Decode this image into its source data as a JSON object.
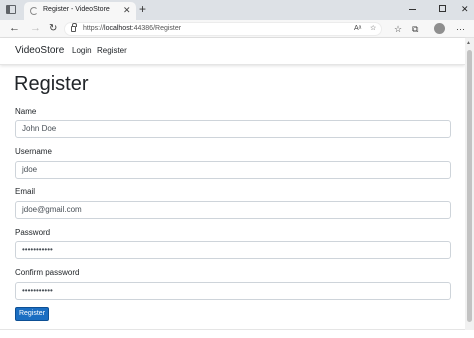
{
  "browser": {
    "tab_title": "Register - VideoStore",
    "tab_close": "✕",
    "new_tab": "+",
    "url_scheme": "https://",
    "url_host": "localhost",
    "url_rest": ":44386/Register",
    "window_buttons": {
      "close": "✕"
    },
    "nav": {
      "back": "←",
      "forward": "→",
      "reload": "↻"
    },
    "omni_icons": {
      "read_aloud": "Aᵃ",
      "favorite": "☆"
    },
    "toolbar_icons": [
      "☆",
      "⧉",
      "⊕"
    ],
    "more": "⋯"
  },
  "navbar": {
    "brand": "VideoStore",
    "links": [
      "Login",
      "Register"
    ]
  },
  "form": {
    "title": "Register",
    "fields": [
      {
        "label": "Name",
        "value": "John Doe"
      },
      {
        "label": "Username",
        "value": "jdoe"
      },
      {
        "label": "Email",
        "value": "jdoe@gmail.com"
      },
      {
        "label": "Password",
        "value": "•••••••••••"
      },
      {
        "label": "Confirm password",
        "value": "•••••••••••"
      }
    ],
    "submit_label": "Register"
  },
  "colors": {
    "accent": "#1b6ec2",
    "tabstrip": "#dde1e6",
    "input_border": "#ced4da"
  }
}
